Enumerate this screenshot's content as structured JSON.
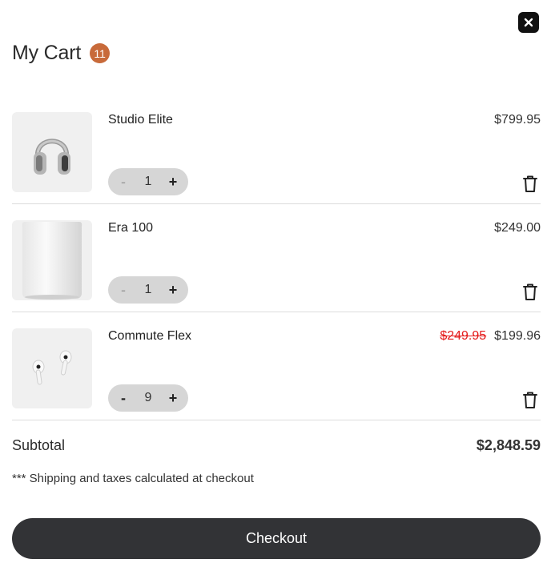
{
  "header": {
    "title": "My Cart",
    "count_badge": "11"
  },
  "icons": {
    "close": "close-icon",
    "trash": "trash-icon"
  },
  "cart": {
    "items": [
      {
        "name": "Studio Elite",
        "price": "$799.95",
        "old_price": "",
        "quantity": "1",
        "minus": "-",
        "plus": "+",
        "image": "headphones"
      },
      {
        "name": "Era 100",
        "price": "$249.00",
        "old_price": "",
        "quantity": "1",
        "minus": "-",
        "plus": "+",
        "image": "speaker"
      },
      {
        "name": "Commute Flex",
        "price": "$199.96",
        "old_price": "$249.95",
        "quantity": "9",
        "minus": "-",
        "plus": "+",
        "image": "earbuds"
      }
    ]
  },
  "summary": {
    "subtotal_label": "Subtotal",
    "subtotal_value": "$2,848.59",
    "note": "*** Shipping and taxes calculated at checkout"
  },
  "checkout": {
    "label": "Checkout"
  },
  "colors": {
    "badge": "#c86a3a",
    "sale_price": "#e41b1b",
    "checkout_bg": "#323336"
  }
}
